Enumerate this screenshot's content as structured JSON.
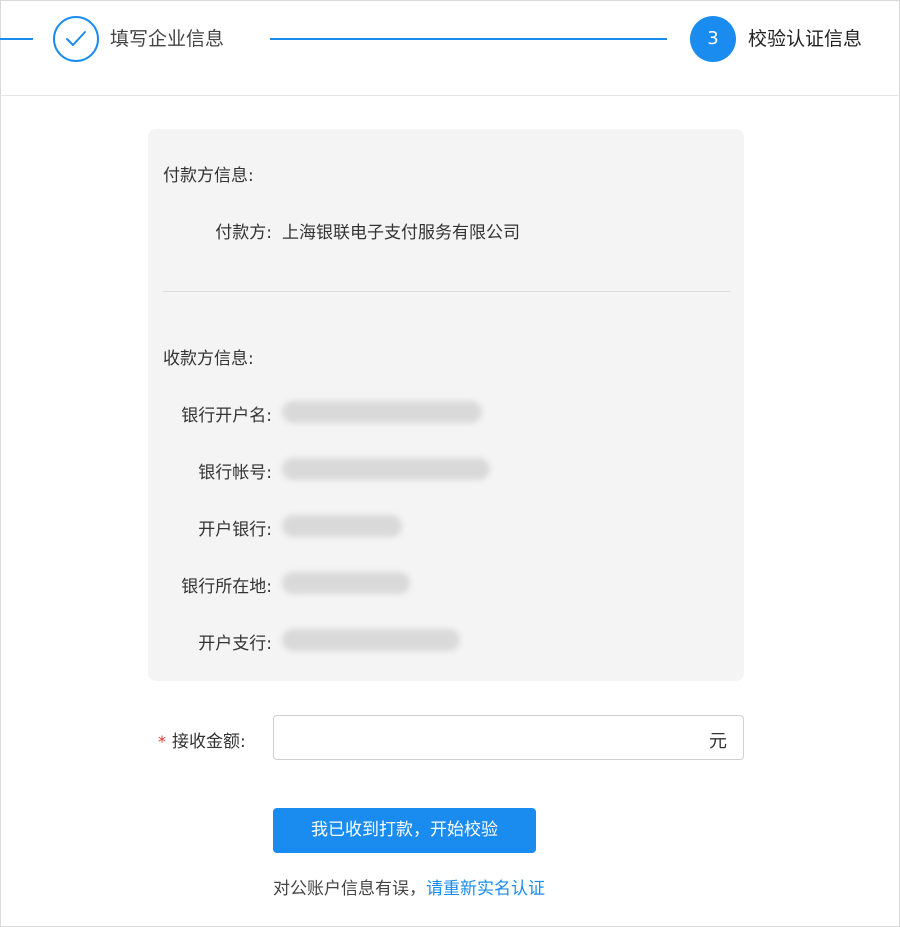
{
  "steps": {
    "step1": {
      "label": "填写企业信息",
      "status": "done"
    },
    "step3": {
      "number": "3",
      "label": "校验认证信息",
      "status": "active"
    }
  },
  "payer": {
    "section_title": "付款方信息:",
    "rows": [
      {
        "label": "付款方:",
        "value": "上海银联电子支付服务有限公司"
      }
    ]
  },
  "payee": {
    "section_title": "收款方信息:",
    "rows": [
      {
        "label": "银行开户名:",
        "value": ""
      },
      {
        "label": "银行帐号:",
        "value": ""
      },
      {
        "label": "开户银行:",
        "value": ""
      },
      {
        "label": "银行所在地:",
        "value": ""
      },
      {
        "label": "开户支行:",
        "value": ""
      }
    ]
  },
  "amount": {
    "required_mark": "*",
    "label": "接收金额:",
    "value": "",
    "unit": "元"
  },
  "confirm_button": {
    "label": "我已收到打款，开始校验"
  },
  "footer": {
    "note": "对公账户信息有误，",
    "link": "请重新实名认证"
  },
  "colors": {
    "accent": "#1a8cf0",
    "required": "#e5352b",
    "card_bg": "#f4f4f4"
  }
}
